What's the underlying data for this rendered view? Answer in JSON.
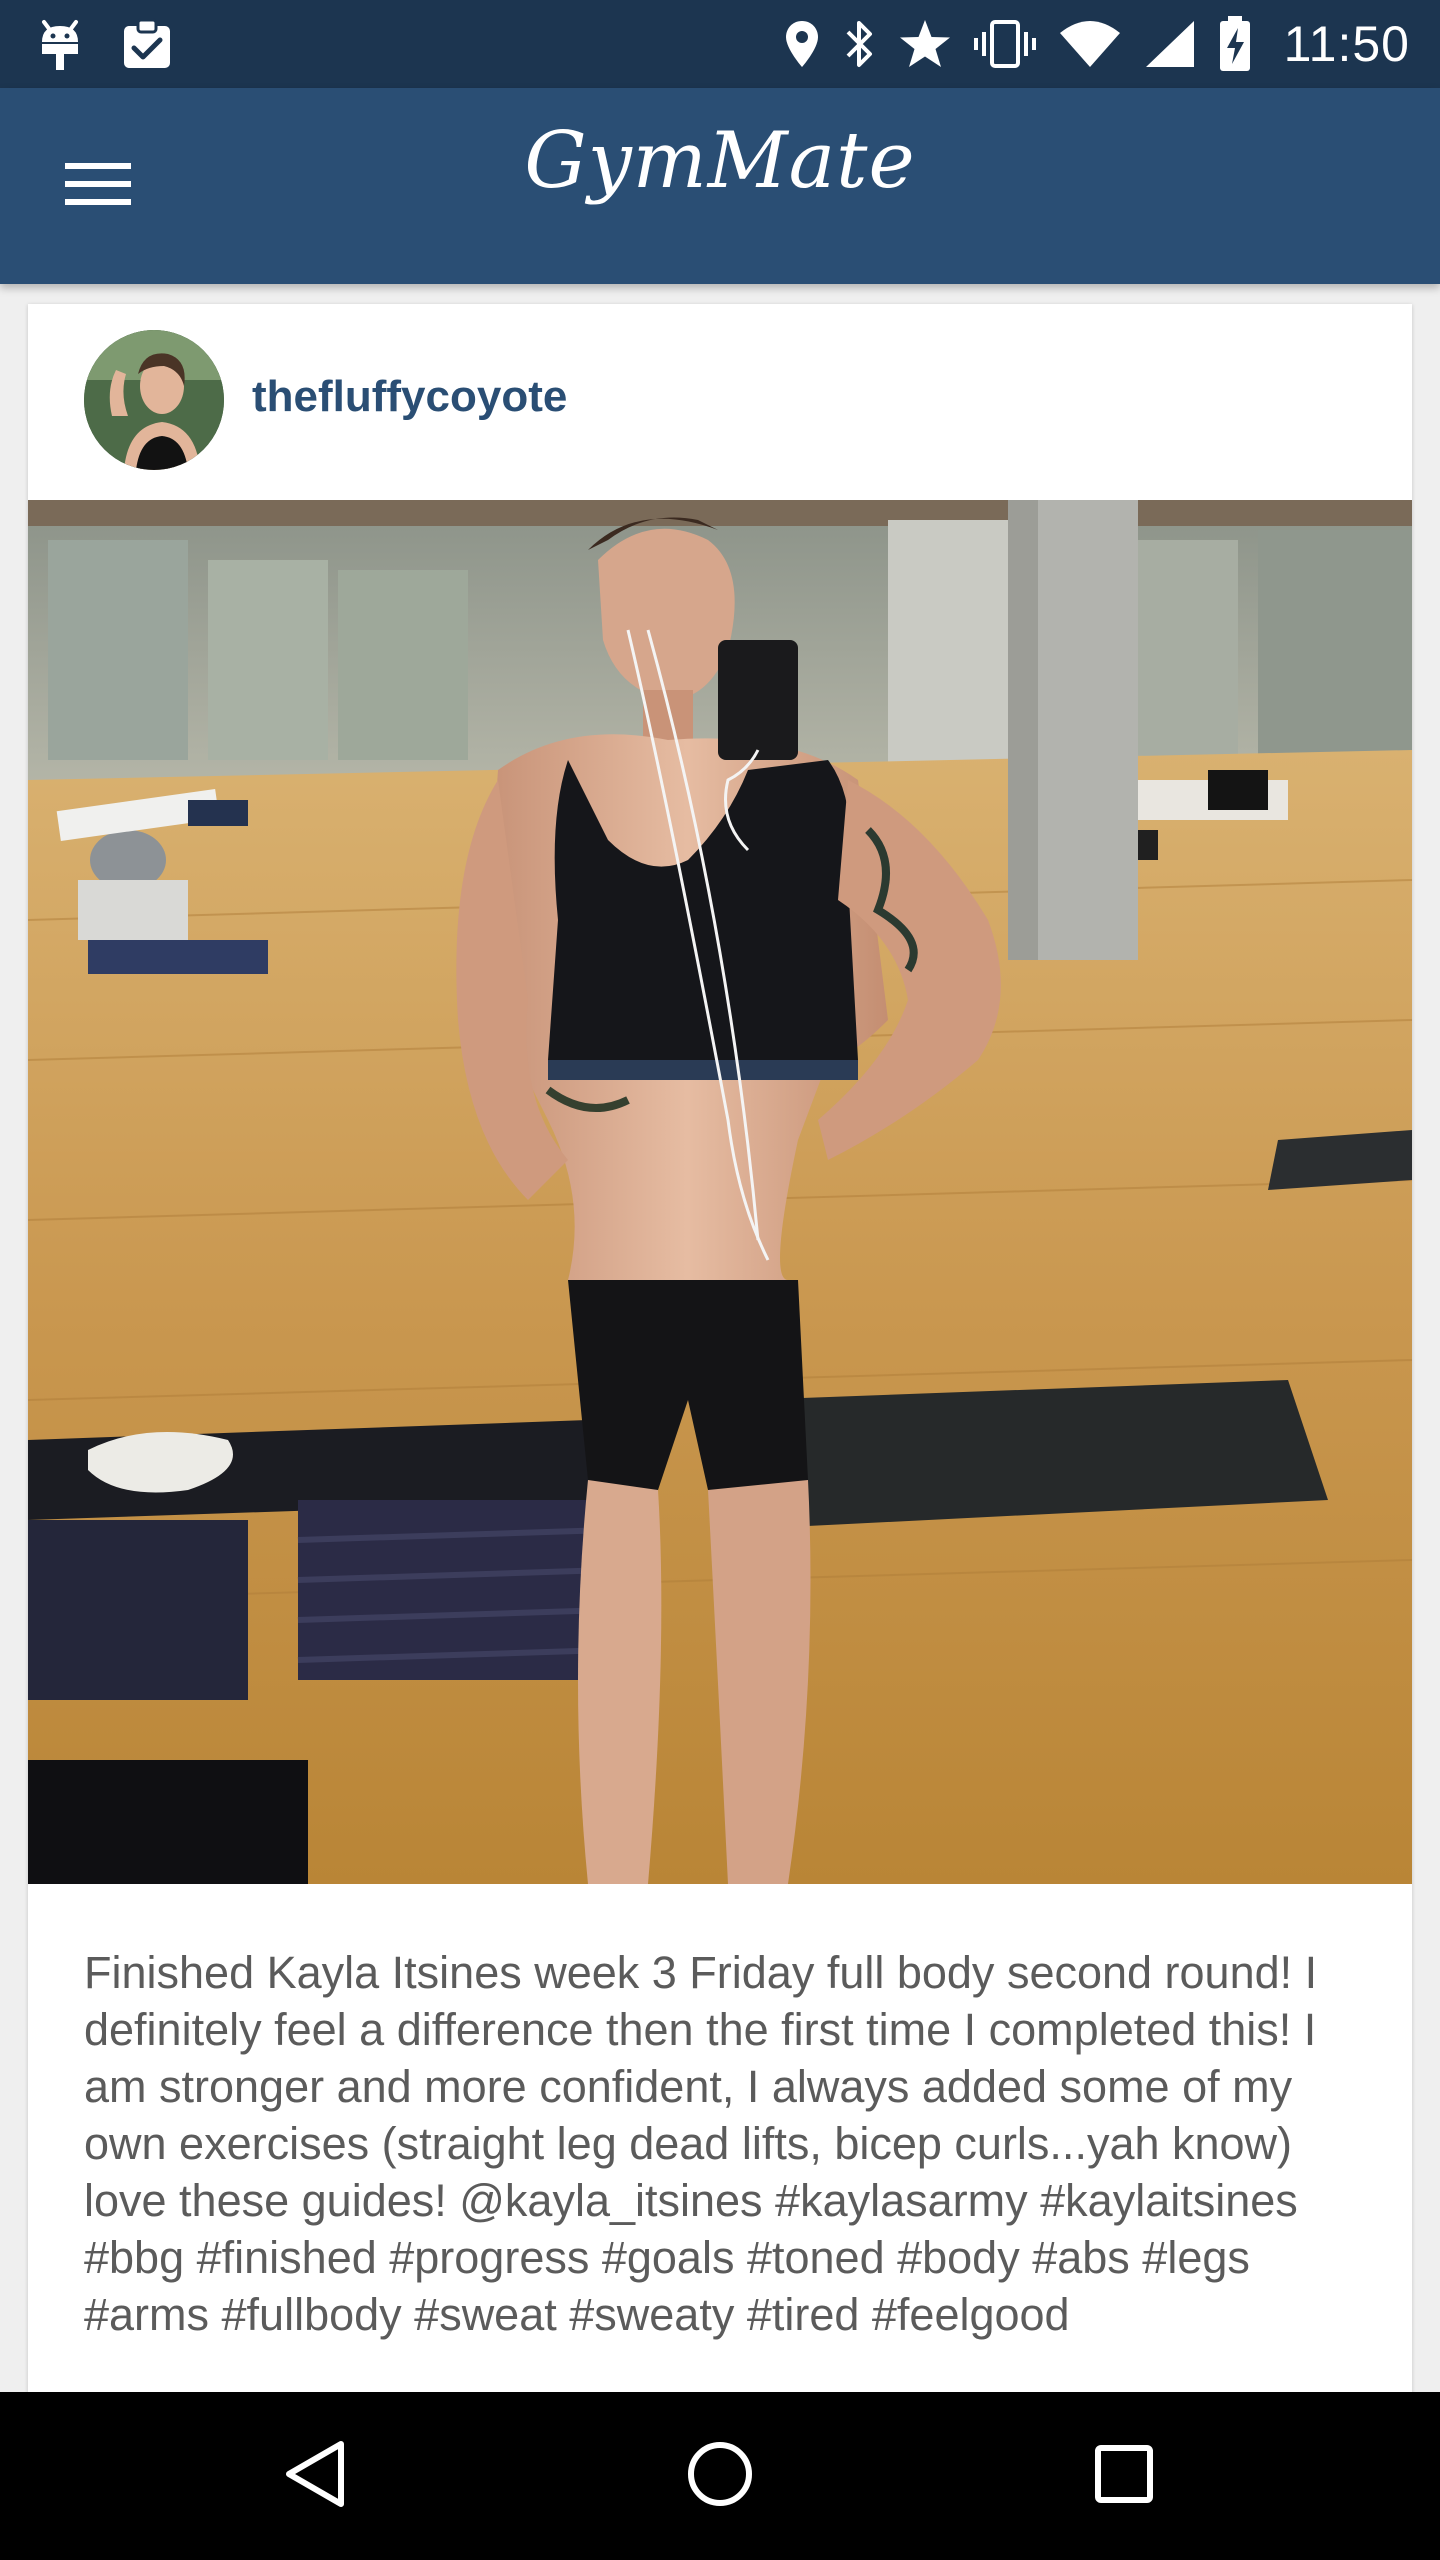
{
  "status_bar": {
    "time": "11:50",
    "left_icons": [
      "android-debug-icon",
      "clipboard-check-icon"
    ],
    "right_icons": [
      "location-pin-icon",
      "bluetooth-icon",
      "star-icon",
      "vibrate-icon",
      "wifi-icon",
      "cell-signal-icon",
      "battery-charging-icon"
    ]
  },
  "app_bar": {
    "title": "GymMate",
    "menu_icon": "hamburger-menu-icon"
  },
  "post": {
    "username": "thefluffycoyote",
    "caption": "Finished Kayla Itsines week 3 Friday full body second round! I definitely feel a difference then the first time I completed this! I am stronger and more confident, I always added some of my own exercises (straight leg dead lifts, bicep curls...yah know) love these guides! @kayla_itsines #kaylasarmy #kaylaitsines #bbg #finished #progress #goals #toned #body #abs #legs #arms #fullbody #sweat #sweaty #tired #feelgood"
  },
  "nav_bar": {
    "icons": [
      "back-triangle-icon",
      "home-circle-icon",
      "recents-square-icon"
    ]
  },
  "colors": {
    "status_bar": "#1c3550",
    "app_bar": "#2a4e74",
    "username": "#2a4e74",
    "caption_text": "#5b5b5b",
    "nav_bar": "#000000"
  }
}
